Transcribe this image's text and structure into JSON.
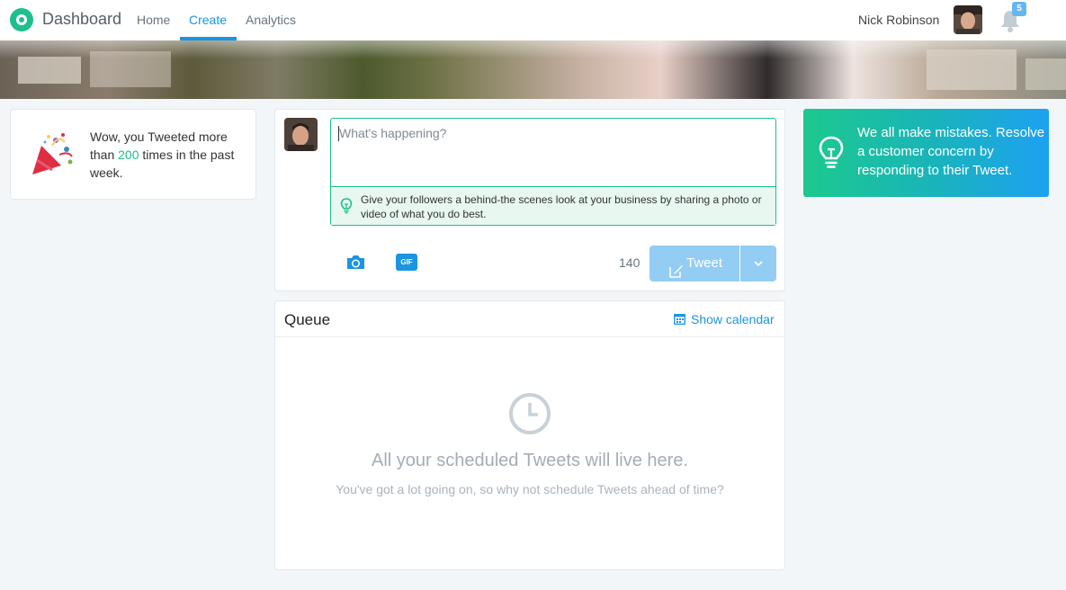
{
  "nav": {
    "brand": "Dashboard",
    "links": [
      "Home",
      "Create",
      "Analytics"
    ],
    "active": "Create",
    "user_name": "Nick Robinson",
    "notification_count": "5"
  },
  "achievement": {
    "prefix": "Wow, you Tweeted more than",
    "count": "200",
    "suffix": "times in the past week.",
    "accent_color": "#1dbf8e"
  },
  "compose": {
    "placeholder": "What's happening?",
    "tip": "Give your followers a behind-the scenes look at your business by sharing a photo or video of what you do best.",
    "gif_label": "GIF",
    "char_count": "140",
    "tweet_label": "Tweet"
  },
  "queue": {
    "title": "Queue",
    "calendar_link": "Show calendar",
    "empty_title": "All your scheduled Tweets will live here.",
    "empty_subtitle": "You've got a lot going on, so why not schedule Tweets ahead of time?"
  },
  "tip_card": {
    "text": "We all make mistakes. Resolve a customer concern by responding to their Tweet."
  },
  "colors": {
    "brand_green": "#1dbf8e",
    "link_blue": "#1b95e0",
    "tweet_button": "#93cdf4"
  }
}
